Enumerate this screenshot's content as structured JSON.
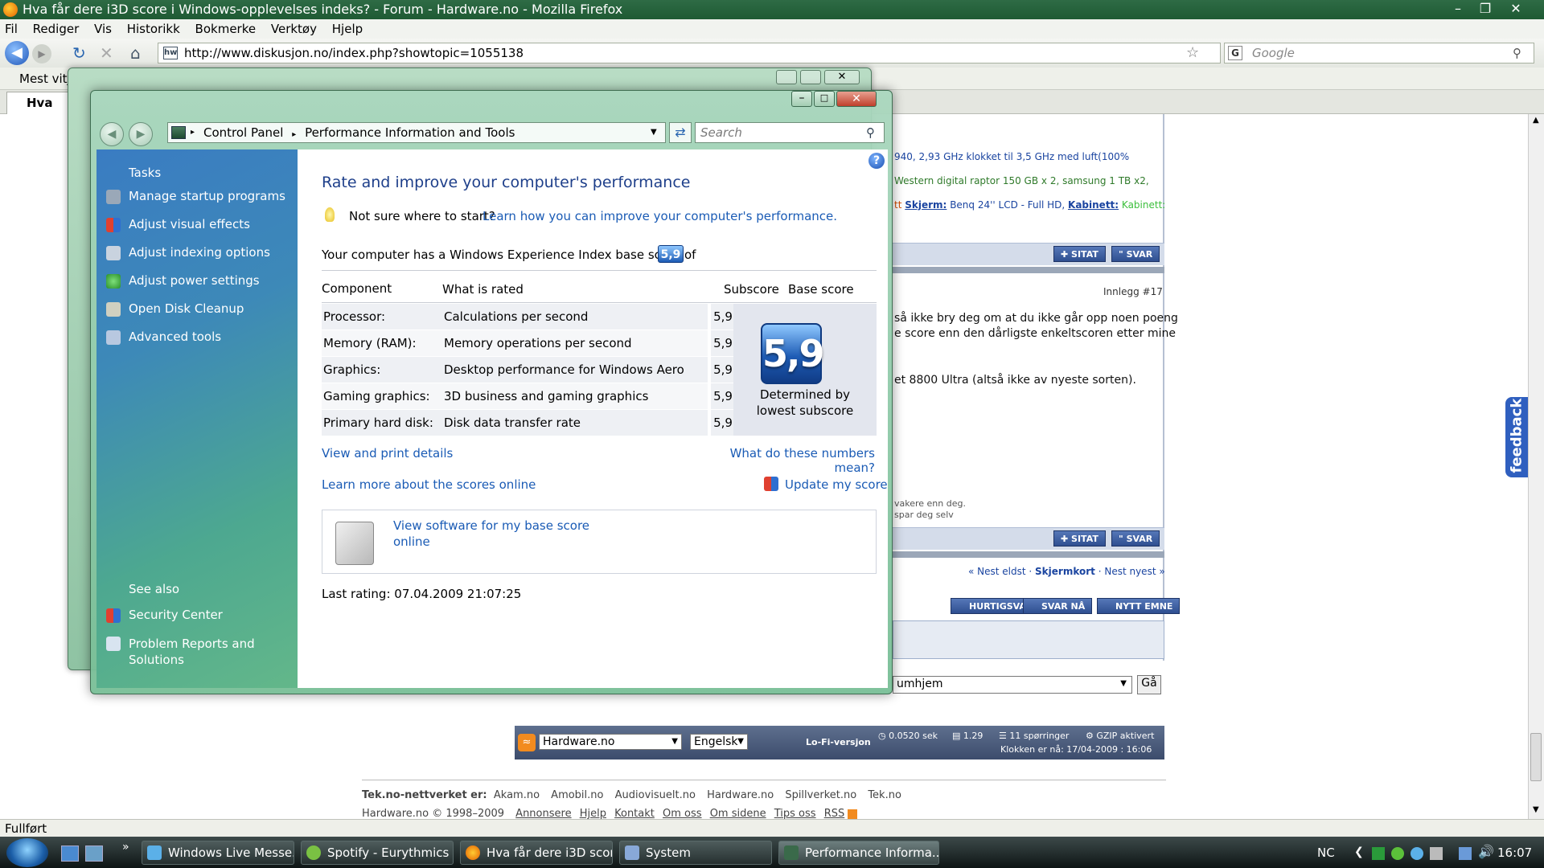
{
  "firefox": {
    "title": "Hva får dere i3D score i Windows-opplevelses indeks? - Forum - Hardware.no - Mozilla Firefox",
    "menu": [
      "Fil",
      "Rediger",
      "Vis",
      "Historikk",
      "Bokmerke",
      "Verktøy",
      "Hjelp"
    ],
    "url": "http://www.diskusjon.no/index.php?showtopic=1055138",
    "search_placeholder": "Google",
    "bookmarks_label": "Mest vitja",
    "tab_label": "Hva får",
    "status": "Fullført"
  },
  "forum": {
    "sig_line1": "940, 2,93 GHz klokket til 3,5 GHz med luft(100%",
    "sig_line2": "Western digital raptor 150 GB x 2, samsung 1 TB x2,",
    "sig_line3_prefix": "tt",
    "sig_skjerm_label": "Skjerm:",
    "sig_skjerm_value": "Benq 24'' LCD - Full HD,",
    "sig_kabinett_label": "Kabinett:",
    "sig_kabinett_value": "Kabinett:",
    "btn_sitat": "SITAT",
    "btn_svar": "SVAR",
    "post_number": "Innlegg #17",
    "post_line1": "så ikke bry deg om at du ikke går opp noen poeng",
    "post_line2": "e score enn den dårligste enkeltscoren etter mine",
    "post_line3": "et 8800 Ultra (altså ikke av nyeste sorten).",
    "sig2_line1": "vakere enn deg.",
    "sig2_line2": "spar deg selv",
    "nav_prev": "« Nest eldst",
    "nav_topic": "Skjermkort",
    "nav_next": "Nest nyest »",
    "btn_hurtigsvar": "HURTIGSVAR",
    "btn_svar_na": "SVAR NÅ",
    "btn_nytt_emne": "NYTT EMNE",
    "jump_value": "umhjem",
    "jump_go": "Gå",
    "footer_site_select": "Hardware.no",
    "footer_lang_select": "Engelsk",
    "footer_lofi": "Lo-Fi-versjon",
    "footer_time": "0.0520 sek",
    "footer_load": "1.29",
    "footer_queries": "11 spørringer",
    "footer_gzip": "GZIP aktivert",
    "footer_clock": "Klokken er nå: 17/04-2009 : 16:06",
    "network_label": "Tek.no-nettverket er:",
    "network_sites": [
      "Akam.no",
      "Amobil.no",
      "Audiovisuelt.no",
      "Hardware.no",
      "Spillverket.no",
      "Tek.no"
    ],
    "copyright": "Hardware.no © 1998–2009",
    "footer_links": [
      "Annonsere",
      "Hjelp",
      "Kontakt",
      "Om oss",
      "Om sidene",
      "Tips oss",
      "RSS"
    ],
    "feedback": "feedback"
  },
  "perf": {
    "breadcrumb": [
      "Control Panel",
      "Performance Information and Tools"
    ],
    "search_placeholder": "Search",
    "tasks_heading": "Tasks",
    "tasks": [
      "Manage startup programs",
      "Adjust visual effects",
      "Adjust indexing options",
      "Adjust power settings",
      "Open Disk Cleanup",
      "Advanced tools"
    ],
    "see_also_heading": "See also",
    "see_also": [
      "Security Center",
      "Problem Reports and Solutions"
    ],
    "heading": "Rate and improve your computer's performance",
    "tip_text": "Not sure where to start?",
    "tip_link": "Learn how you can improve your computer's performance.",
    "base_score_text": "Your computer has a Windows Experience Index base score of",
    "base_score": "5,9",
    "col_component": "Component",
    "col_what": "What is rated",
    "col_subscore": "Subscore",
    "col_base": "Base score",
    "rows": [
      {
        "component": "Processor:",
        "what": "Calculations per second",
        "subscore": "5,9"
      },
      {
        "component": "Memory (RAM):",
        "what": "Memory operations per second",
        "subscore": "5,9"
      },
      {
        "component": "Graphics:",
        "what": "Desktop performance for Windows Aero",
        "subscore": "5,9"
      },
      {
        "component": "Gaming graphics:",
        "what": "3D business and gaming graphics performance",
        "subscore": "5,9"
      },
      {
        "component": "Primary hard disk:",
        "what": "Disk data transfer rate",
        "subscore": "5,9"
      }
    ],
    "determined_line1": "Determined by",
    "determined_line2": "lowest subscore",
    "link_print": "View and print details",
    "link_numbers": "What do these numbers mean?",
    "link_learn": "Learn more about the scores online",
    "link_update": "Update my score",
    "software_line1": "View software for my base score",
    "software_line2": "online",
    "last_rating": "Last rating: 07.04.2009 21:07:25"
  },
  "taskbar": {
    "items": [
      "Windows Live Messe...",
      "Spotify - Eurythmics ...",
      "Hva får dere i3D scor...",
      "System",
      "Performance Informa..."
    ],
    "lang": "NC",
    "clock": "16:07"
  },
  "colors": {
    "accent_blue": "#1a5bb5",
    "firefox_title": "#1e5a33",
    "taskbar": "#0e1515"
  }
}
